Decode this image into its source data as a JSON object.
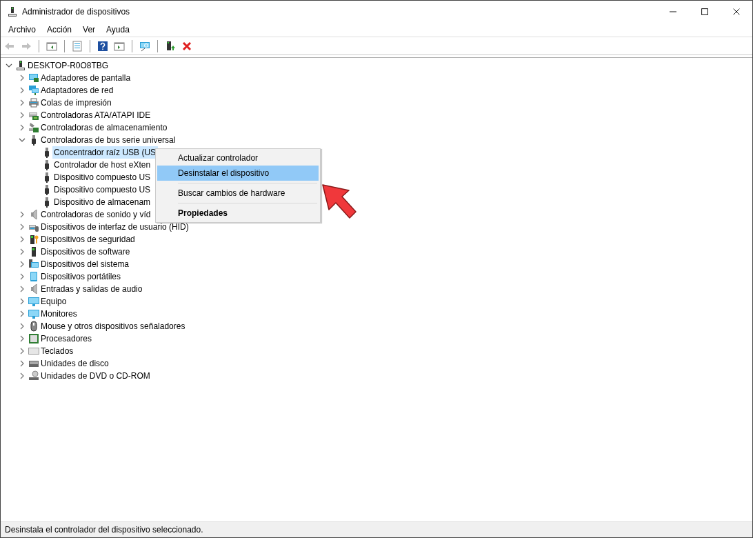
{
  "window": {
    "title": "Administrador de dispositivos"
  },
  "menu_bar": [
    {
      "label": "Archivo"
    },
    {
      "label": "Acción"
    },
    {
      "label": "Ver"
    },
    {
      "label": "Ayuda"
    }
  ],
  "toolbar": [
    {
      "kind": "back",
      "disabled": true
    },
    {
      "kind": "forward",
      "disabled": true
    },
    {
      "kind": "separator"
    },
    {
      "kind": "panel",
      "disabled": false
    },
    {
      "kind": "separator"
    },
    {
      "kind": "properties",
      "disabled": false
    },
    {
      "kind": "separator"
    },
    {
      "kind": "help",
      "disabled": false
    },
    {
      "kind": "panel2",
      "disabled": false
    },
    {
      "kind": "separator"
    },
    {
      "kind": "scan",
      "disabled": false
    },
    {
      "kind": "separator"
    },
    {
      "kind": "update",
      "disabled": false
    },
    {
      "kind": "remove",
      "disabled": false
    }
  ],
  "tree": {
    "label": "DESKTOP-R0O8TBG",
    "kind": "computer",
    "expanded": true,
    "selected": false,
    "children": [
      {
        "label": "Adaptadores de pantalla",
        "kind": "display",
        "expanded": false,
        "selected": false
      },
      {
        "label": "Adaptadores de red",
        "kind": "network",
        "expanded": false,
        "selected": false
      },
      {
        "label": "Colas de impresión",
        "kind": "printer",
        "expanded": false,
        "selected": false
      },
      {
        "label": "Controladoras ATA/ATAPI IDE",
        "kind": "ide",
        "expanded": false,
        "selected": false
      },
      {
        "label": "Controladoras de almacenamiento",
        "kind": "storage",
        "expanded": false,
        "selected": false
      },
      {
        "label": "Controladoras de bus serie universal",
        "kind": "usb",
        "expanded": true,
        "selected": false,
        "children": [
          {
            "label": "Concentrador raíz USB (US",
            "kind": "usb",
            "selected": true
          },
          {
            "label": "Controlador de host eXten",
            "kind": "usb",
            "selected": false
          },
          {
            "label": "Dispositivo compuesto US",
            "kind": "usb",
            "selected": false
          },
          {
            "label": "Dispositivo compuesto US",
            "kind": "usb",
            "selected": false
          },
          {
            "label": "Dispositivo de almacenam",
            "kind": "usb",
            "selected": false
          }
        ]
      },
      {
        "label": "Controladoras de sonido y víd",
        "kind": "speaker",
        "expanded": false,
        "selected": false
      },
      {
        "label": "Dispositivos de interfaz de usuario (HID)",
        "kind": "hid",
        "expanded": false,
        "selected": false
      },
      {
        "label": "Dispositivos de seguridad",
        "kind": "security",
        "expanded": false,
        "selected": false
      },
      {
        "label": "Dispositivos de software",
        "kind": "software",
        "expanded": false,
        "selected": false
      },
      {
        "label": "Dispositivos del sistema",
        "kind": "system",
        "expanded": false,
        "selected": false
      },
      {
        "label": "Dispositivos portátiles",
        "kind": "portable",
        "expanded": false,
        "selected": false
      },
      {
        "label": "Entradas y salidas de audio",
        "kind": "speaker",
        "expanded": false,
        "selected": false
      },
      {
        "label": "Equipo",
        "kind": "monitor",
        "expanded": false,
        "selected": false
      },
      {
        "label": "Monitores",
        "kind": "monitor",
        "expanded": false,
        "selected": false
      },
      {
        "label": "Mouse y otros dispositivos señaladores",
        "kind": "mouse",
        "expanded": false,
        "selected": false
      },
      {
        "label": "Procesadores",
        "kind": "cpu",
        "expanded": false,
        "selected": false
      },
      {
        "label": "Teclados",
        "kind": "keyboard",
        "expanded": false,
        "selected": false
      },
      {
        "label": "Unidades de disco",
        "kind": "disk",
        "expanded": false,
        "selected": false
      },
      {
        "label": "Unidades de DVD o CD-ROM",
        "kind": "dvd",
        "expanded": false,
        "selected": false
      }
    ]
  },
  "context_menu": [
    {
      "kind": "item",
      "label": "Actualizar controlador",
      "selected": false,
      "default": false
    },
    {
      "kind": "item",
      "label": "Desinstalar el dispositivo",
      "selected": true,
      "default": false
    },
    {
      "kind": "separator"
    },
    {
      "kind": "item",
      "label": "Buscar cambios de hardware",
      "selected": false,
      "default": false
    },
    {
      "kind": "separator"
    },
    {
      "kind": "item",
      "label": "Propiedades",
      "selected": false,
      "default": true
    }
  ],
  "status_bar": {
    "text": "Desinstala el controlador del dispositivo seleccionado."
  }
}
